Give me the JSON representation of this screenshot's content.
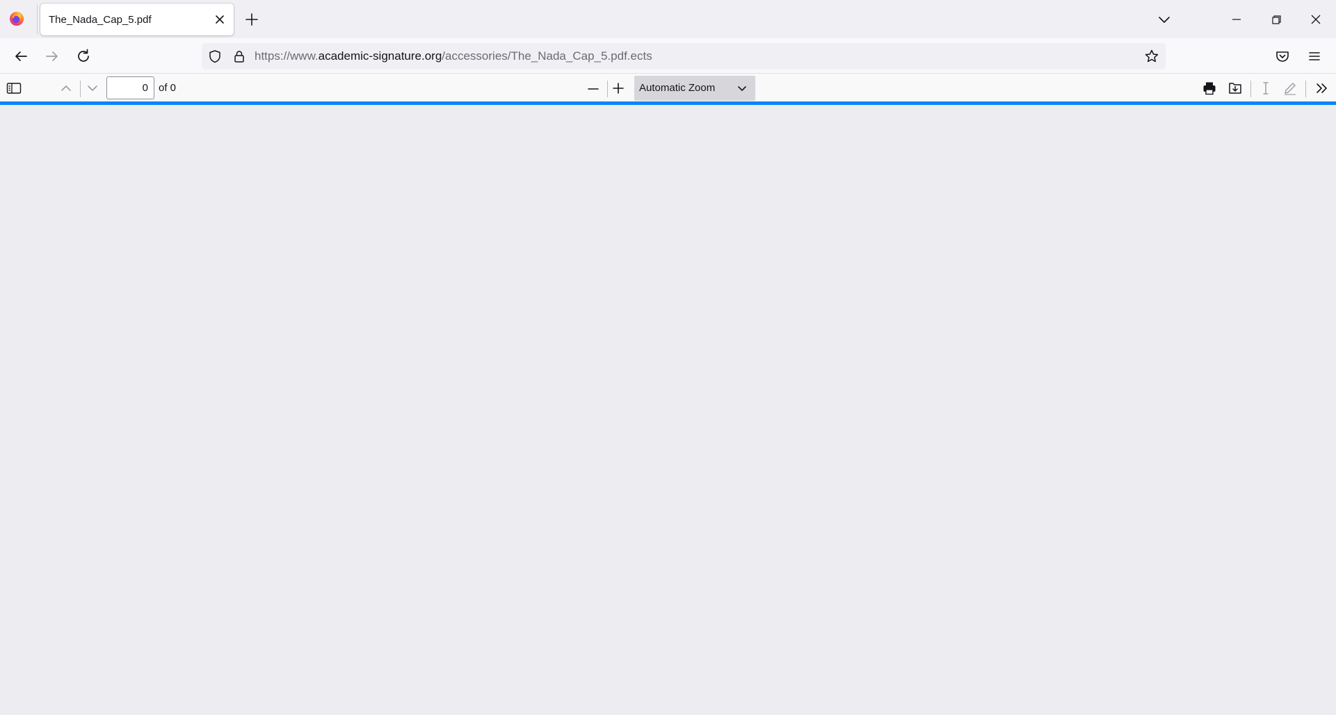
{
  "browser": {
    "tab": {
      "title": "The_Nada_Cap_5.pdf"
    },
    "url": {
      "prefix": "https://www.",
      "host": "academic-signature.org",
      "path": "/accessories/The_Nada_Cap_5.pdf.ects"
    }
  },
  "pdf_toolbar": {
    "page_number": "0",
    "page_of": "of 0",
    "zoom": "Automatic Zoom"
  },
  "colors": {
    "accent": "#0a84ff",
    "viewer_bg": "#edecf1",
    "toolbar_bg": "#f9f9fa"
  },
  "icons": [
    "firefox-logo-icon",
    "close-icon",
    "plus-icon",
    "chevron-down-icon",
    "minimize-icon",
    "restore-icon",
    "back-icon",
    "forward-icon",
    "reload-icon",
    "shield-icon",
    "lock-icon",
    "star-icon",
    "pocket-icon",
    "hamburger-menu-icon",
    "sidebar-toggle-icon",
    "chevron-up-icon",
    "minus-icon",
    "print-icon",
    "download-icon",
    "text-cursor-icon",
    "pen-icon",
    "double-chevron-right-icon"
  ]
}
